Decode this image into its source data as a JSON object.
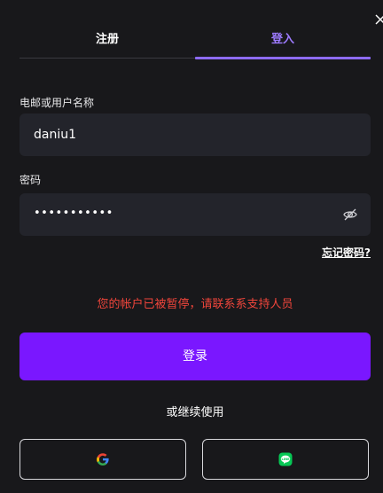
{
  "tabs": {
    "signup": "注册",
    "login": "登入",
    "active": "login"
  },
  "form": {
    "username_label": "电邮或用户名称",
    "username_value": "daniu1",
    "password_label": "密码",
    "password_masked": "•••••••••••",
    "forgot_link": "忘记密码?",
    "error_message": "您的帐户已被暂停，请联系系支持人员",
    "login_button": "登录",
    "alt_text": "或继续使用"
  },
  "social": [
    {
      "name": "google",
      "icon": "google-icon"
    },
    {
      "name": "line",
      "icon": "line-icon"
    }
  ],
  "colors": {
    "accent": "#7a17ff",
    "tab_active": "#9d7bff",
    "error": "#f0453b",
    "background": "#18181b",
    "field": "#23242b"
  }
}
